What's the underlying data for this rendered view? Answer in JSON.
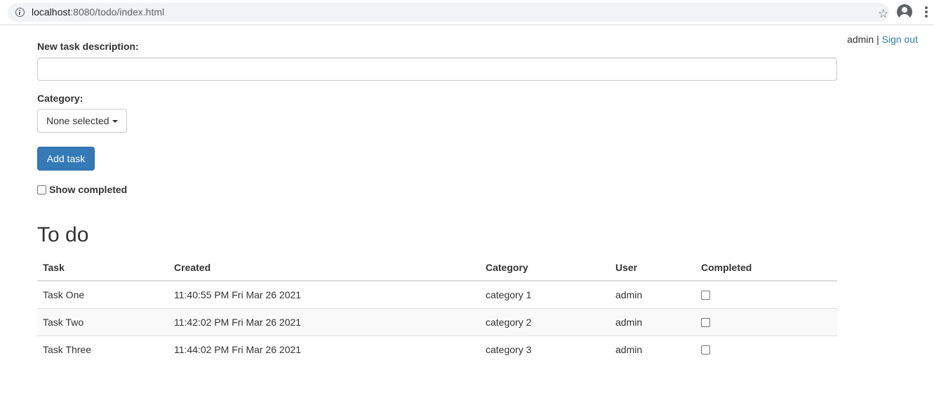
{
  "browser": {
    "url_host": "localhost",
    "url_rest": ":8080/todo/index.html",
    "icons": {
      "info": "info-icon",
      "star": "star-icon",
      "profile": "account-circle-icon",
      "menu": "more-vert-icon"
    }
  },
  "user": {
    "name": "admin",
    "separator": "|",
    "sign_out": "Sign out"
  },
  "form": {
    "description_label": "New task description:",
    "description_value": "",
    "category_label": "Category:",
    "category_selected": "None selected",
    "add_button": "Add task",
    "show_completed_label": "Show completed"
  },
  "todo": {
    "title": "To do",
    "columns": [
      "Task",
      "Created",
      "Category",
      "User",
      "Completed"
    ],
    "rows": [
      {
        "task": "Task One",
        "created": "11:40:55 PM Fri Mar 26 2021",
        "category": "category 1",
        "user": "admin",
        "completed": false
      },
      {
        "task": "Task Two",
        "created": "11:42:02 PM Fri Mar 26 2021",
        "category": "category 2",
        "user": "admin",
        "completed": false
      },
      {
        "task": "Task Three",
        "created": "11:44:02 PM Fri Mar 26 2021",
        "category": "category 3",
        "user": "admin",
        "completed": false
      }
    ]
  },
  "colors": {
    "link": "#337ab7",
    "primary_button": "#337ab7",
    "text": "#333333",
    "striped_row": "#f9f9f9"
  }
}
